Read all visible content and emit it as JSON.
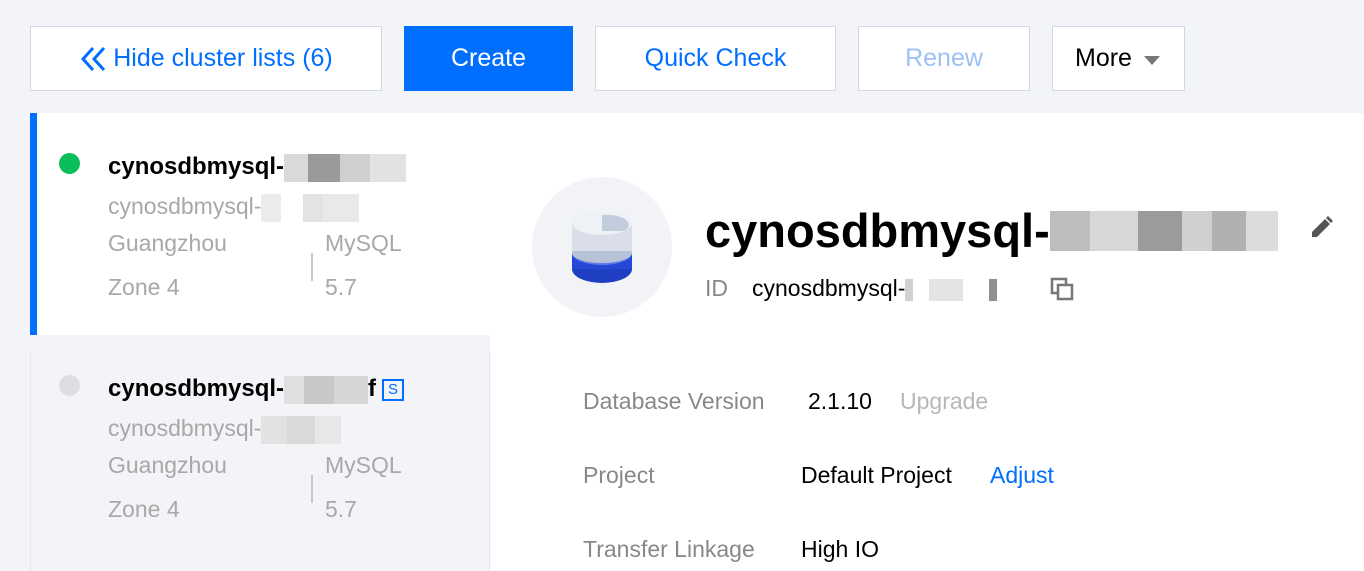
{
  "toolbar": {
    "hide_lists": "Hide cluster lists (6)",
    "create": "Create",
    "quick_check": "Quick Check",
    "renew": "Renew",
    "more": "More"
  },
  "clusters": [
    {
      "name_prefix": "cynosdbmysql-",
      "sub_prefix": "cynosdbmysql-",
      "region": "Guangzhou",
      "zone": "Zone 4",
      "engine": "MySQL",
      "version": "5.7",
      "status": "running"
    },
    {
      "name_prefix": "cynosdbmysql-",
      "name_tail": "f",
      "badge": "S",
      "sub_prefix": "cynosdbmysql-",
      "region": "Guangzhou",
      "zone": "Zone 4",
      "engine": "MySQL",
      "version": "5.7",
      "status": "inactive"
    }
  ],
  "detail": {
    "title_prefix": "cynosdbmysql-",
    "id_label": "ID",
    "id_prefix": "cynosdbmysql-",
    "db_version_label": "Database Version",
    "db_version": "2.1.10",
    "upgrade": "Upgrade",
    "project_label": "Project",
    "project": "Default Project",
    "adjust": "Adjust",
    "transfer_label": "Transfer Linkage",
    "transfer": "High IO"
  },
  "colors": {
    "accent": "#006eff",
    "running": "#0abf5b",
    "disabled_text": "#9cc1f5"
  },
  "icons": [
    "double-chevron-left-icon",
    "caret-down-icon",
    "database-icon",
    "edit-pencil-icon",
    "copy-icon"
  ]
}
